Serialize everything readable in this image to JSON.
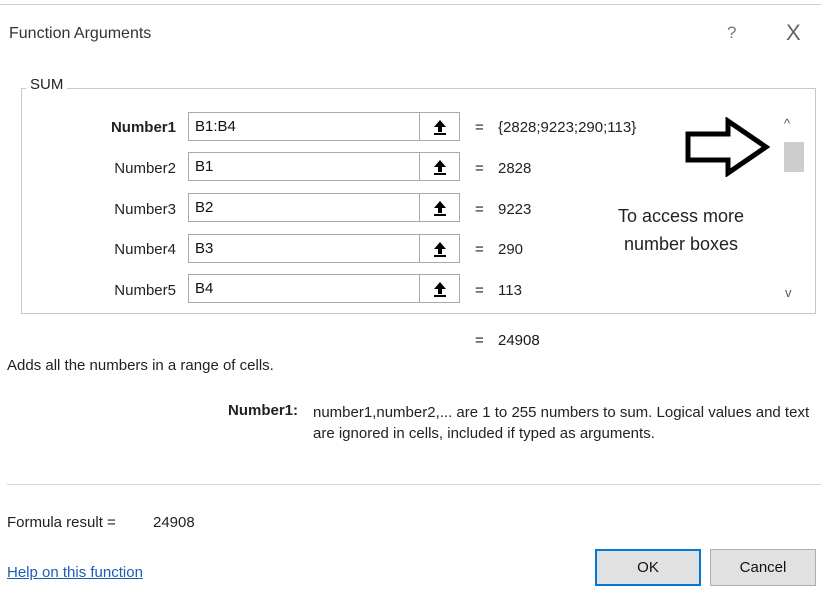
{
  "dialog": {
    "title": "Function Arguments",
    "help_glyph": "?",
    "close_glyph": "X"
  },
  "function": {
    "name": "SUM",
    "arguments": [
      {
        "label": "Number1",
        "bold": true,
        "value": "B1:B4",
        "result": "{2828;9223;290;113}"
      },
      {
        "label": "Number2",
        "bold": false,
        "value": "B1",
        "result": "2828"
      },
      {
        "label": "Number3",
        "bold": false,
        "value": "B2",
        "result": "9223"
      },
      {
        "label": "Number4",
        "bold": false,
        "value": "B3",
        "result": "290"
      },
      {
        "label": "Number5",
        "bold": false,
        "value": "B4",
        "result": "113"
      }
    ],
    "equals_sign": "=",
    "result": "24908"
  },
  "annotation": {
    "text_line1": "To access more",
    "text_line2": "number boxes",
    "arrow_icon": "right-arrow-outline-icon"
  },
  "scrollbar": {
    "up_glyph": "^",
    "down_glyph": "v"
  },
  "description": "Adds all the numbers in a range of cells.",
  "argument_help": {
    "label": "Number1:",
    "text": "number1,number2,... are 1 to 255 numbers to sum. Logical values and text are ignored in cells, included if typed as arguments."
  },
  "formula_result": {
    "label": "Formula result =",
    "value": "24908"
  },
  "footer": {
    "help_link": "Help on this function",
    "ok_label": "OK",
    "cancel_label": "Cancel"
  },
  "colors": {
    "ok_border": "#0078d7",
    "link": "#1a5fb4"
  }
}
